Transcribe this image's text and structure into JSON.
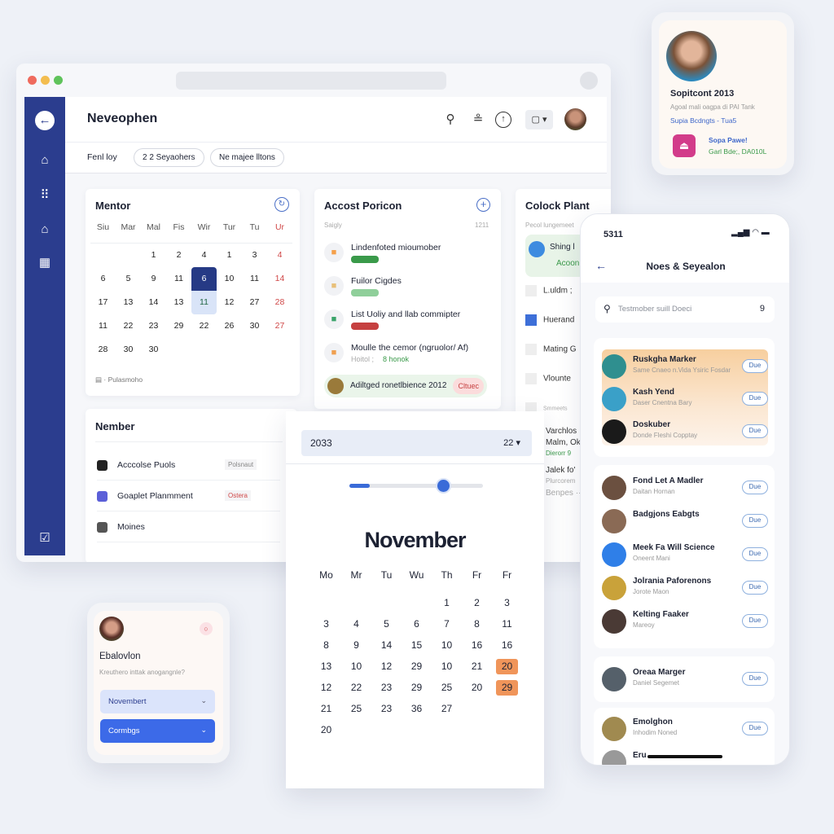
{
  "window": {
    "title": "Neveophen",
    "filter_label": "Fenl loy",
    "chips": [
      "2 2 Seyaohers",
      "Ne majee lltons"
    ]
  },
  "sidebar": {
    "icons": [
      "back-icon",
      "home-icon",
      "grid-icon",
      "home-icon",
      "table-icon",
      "calendar-icon"
    ]
  },
  "header_icons": [
    "search-icon",
    "user-icon",
    "info-icon",
    "window-dropdown-icon"
  ],
  "mentor": {
    "title": "Mentor",
    "days": [
      "Siu",
      "Mar",
      "Mal",
      "Fis",
      "Wir",
      "Tur",
      "Tu",
      "Ur"
    ],
    "rows": [
      [
        "",
        "",
        "1",
        "2",
        "4",
        "1",
        "3",
        "4"
      ],
      [
        "6",
        "5",
        "9",
        "11",
        "6",
        "10",
        "11",
        "14"
      ],
      [
        "17",
        "13",
        "14",
        "13",
        "11",
        "12",
        "27",
        "28"
      ],
      [
        "11",
        "22",
        "23",
        "29",
        "22",
        "26",
        "30",
        "27"
      ],
      [
        "28",
        "30",
        "30",
        "",
        "",
        "",
        "",
        ""
      ]
    ],
    "selected": "6",
    "highlighted": "11",
    "footer": "Pulasmoho"
  },
  "accost": {
    "title": "Accost Poricon",
    "sub_left": "Saigly",
    "sub_right": "1211",
    "items": [
      {
        "title": "Lindenfoted mioumober",
        "badge_color": "#3a9a4a"
      },
      {
        "title": "Fuilor Cigdes",
        "badge_color": "#8fcf9a"
      },
      {
        "title": "List Uoliy and llab commipter",
        "badge_color": "#c64040"
      },
      {
        "title": "Moulle the cemor (ngruolor/ Af)",
        "sub": "Hoitol ;",
        "sub_accent": "8 honok"
      }
    ],
    "footer": "Adiltged ronetlbience 2012",
    "footer_tag": "Cltuec"
  },
  "colock": {
    "title": "Colock Plant",
    "sub": "Pecol lungemeet",
    "feature": "Shing l",
    "feature_sub": "Acoon",
    "rows": [
      "L.uldm ;",
      "Huerand",
      "Mating G",
      "Vlounte",
      "Smmeets"
    ],
    "lower": [
      "Varchlos",
      "Malm, Okt",
      "Dierorr 9",
      "Jalek fo'",
      "Plurcorem",
      "Benpes ···"
    ]
  },
  "nember": {
    "title": "Nember",
    "rows": [
      {
        "label": "Acccolse Puols",
        "tag": "Polsnaut",
        "tag_color": "#888"
      },
      {
        "label": "Goaplet Planmment",
        "tag": "Ostera",
        "tag_color": "#d04848"
      },
      {
        "label": "Moines",
        "tag": ""
      }
    ]
  },
  "popup": {
    "year": "2033",
    "right": "22",
    "month": "November",
    "slider_value": 0.7,
    "days": [
      "Mo",
      "Mr",
      "Tu",
      "Wu",
      "Th",
      "Fr",
      "Fr"
    ],
    "rows": [
      [
        "",
        "",
        "",
        "",
        "1",
        "2",
        "3"
      ],
      [
        "3",
        "4",
        "5",
        "6",
        "7",
        "8",
        "11"
      ],
      [
        "8",
        "9",
        "14",
        "15",
        "10",
        "16",
        "16"
      ],
      [
        "13",
        "10",
        "12",
        "29",
        "10",
        "21",
        "20"
      ],
      [
        "12",
        "22",
        "23",
        "29",
        "25",
        "20",
        "29"
      ],
      [
        "21",
        "25",
        "23",
        "36",
        "27",
        "",
        ""
      ],
      [
        "20",
        "",
        "",
        "",
        "",
        "",
        ""
      ]
    ],
    "accent": "#f0955a"
  },
  "profile": {
    "title": "Sopitcont 2013",
    "line1": "Agoal mali oagpa di PAI Tank",
    "line2": "Supia Bcdngts - Tua5",
    "app_name": "Sopa Pawe!",
    "app_sub": "Garl Bde;, DA010L"
  },
  "phone": {
    "time": "5311",
    "title": "Noes & Seyealon",
    "search_placeholder": "Testmober suill Doeci",
    "search_right": "9",
    "due": "Due",
    "group1": [
      {
        "name": "Ruskgha Marker",
        "sub": "Same Cnaeo n.Vida Ysiric Fosdar"
      },
      {
        "name": "Kash Yend",
        "sub": "Daser Cnentna Bary"
      },
      {
        "name": "Doskuber",
        "sub": "Donde Fleshi Copptay"
      }
    ],
    "group2": [
      {
        "name": "Fond Let A Madler",
        "sub": "Daitan Hornan"
      },
      {
        "name": "Badgjons Eabgts",
        "sub": ""
      },
      {
        "name": "Meek Fa Will Science",
        "sub": "Oneent Mani"
      },
      {
        "name": "Jolrania Paforenons",
        "sub": "Jorote Maon"
      },
      {
        "name": "Kelting Faaker",
        "sub": "Mareoy"
      }
    ],
    "group3": [
      {
        "name": "Oreaa Marger",
        "sub": "Daniel Segemet"
      }
    ],
    "group4": [
      {
        "name": "Emolghon",
        "sub": "Inhodim Noned"
      },
      {
        "name": "Eru",
        "sub": ""
      }
    ]
  },
  "small_card": {
    "title": "Ebalovlon",
    "subtitle": "Kreuthero inttak anogangnle?",
    "select1": "Novembert",
    "select2": "Cormbgs"
  }
}
